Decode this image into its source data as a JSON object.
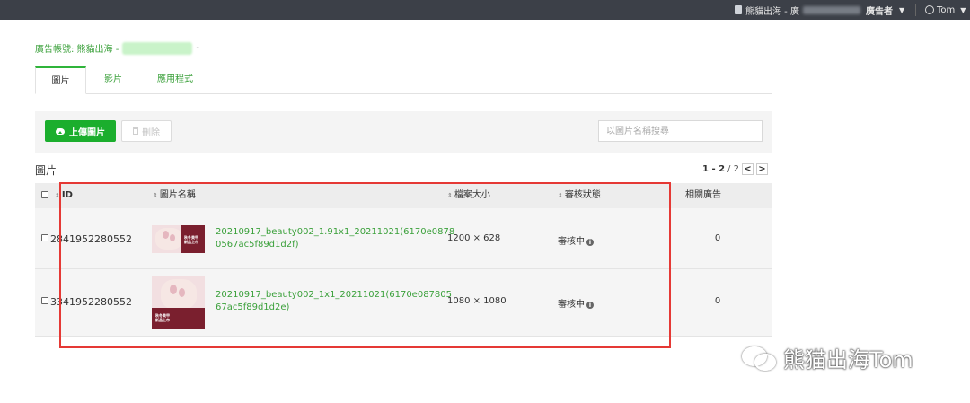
{
  "topbar": {
    "account_label": "熊貓出海 - 廣",
    "role_label": "廣告者",
    "user_name": "Tom"
  },
  "breadcrumb": {
    "label": "廣告帳號: 熊貓出海 -",
    "suffix": "-"
  },
  "tabs": [
    {
      "label": "圖片",
      "active": true
    },
    {
      "label": "影片",
      "active": false
    },
    {
      "label": "應用程式",
      "active": false
    }
  ],
  "toolbar": {
    "upload_label": "上傳圖片",
    "delete_label": "刪除",
    "search_placeholder": "以圖片名稱搜尋"
  },
  "section": {
    "title": "圖片",
    "pager_range": "1 - 2",
    "pager_total": "/ 2",
    "prev": "<",
    "next": ">"
  },
  "table": {
    "headers": {
      "id": "ID",
      "name": "圖片名稱",
      "size": "檔案大小",
      "status": "審核狀態",
      "related": "相關廣告"
    },
    "rows": [
      {
        "id": "2841952280552",
        "name_line1": "20210917_beauty002_1.91x1_20211021(6170e0878",
        "name_line2": "0567ac5f89d1d2f)",
        "size": "1200 × 628",
        "status": "審核中",
        "related": "0"
      },
      {
        "id": "3341952280552",
        "name_line1": "20210917_beauty002_1x1_20211021(6170e087805",
        "name_line2": "67ac5f89d1d2e)",
        "size": "1080 × 1080",
        "status": "審核中",
        "related": "0"
      }
    ]
  },
  "thumbnail_text": {
    "line1": "秋冬美甲",
    "line2": "新品上市"
  },
  "watermark": "熊猫出海Tom",
  "colors": {
    "brand_green": "#1bae2d",
    "link_green": "#3aa03a",
    "highlight_red": "#e53935",
    "topbar": "#3c4048"
  }
}
